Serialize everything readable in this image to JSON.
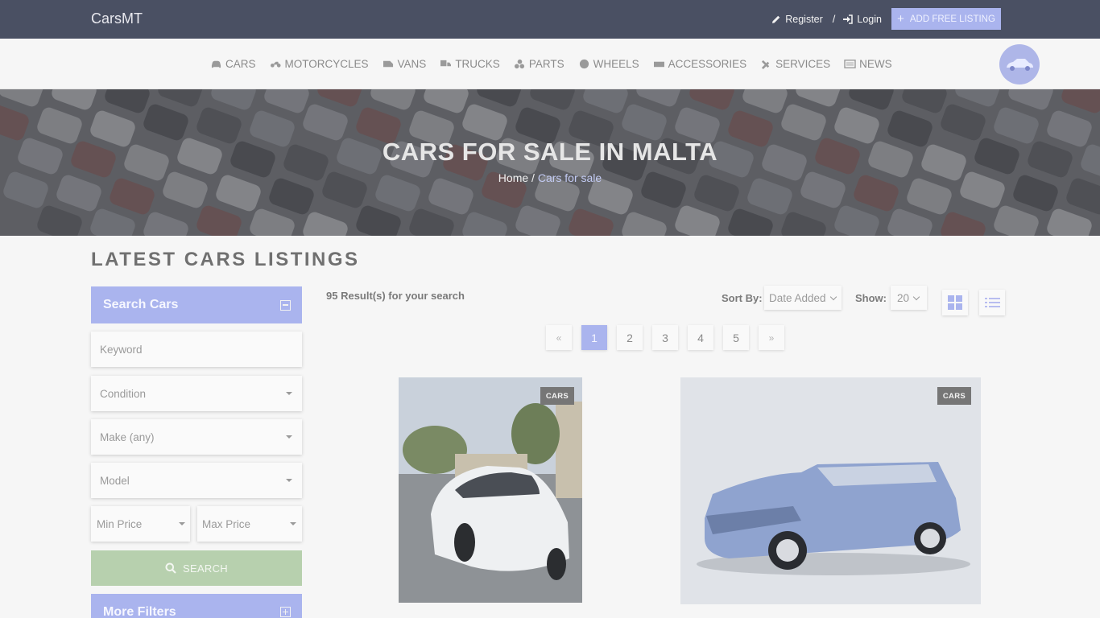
{
  "header": {
    "brand": "CarsMT",
    "register_label": "Register",
    "separator": "/",
    "login_label": "Login",
    "add_listing_label": "ADD FREE LISTING"
  },
  "nav": {
    "items": [
      {
        "label": "CARS",
        "icon": "car-icon"
      },
      {
        "label": "MOTORCYCLES",
        "icon": "motorcycle-icon"
      },
      {
        "label": "VANS",
        "icon": "van-icon"
      },
      {
        "label": "TRUCKS",
        "icon": "truck-icon"
      },
      {
        "label": "PARTS",
        "icon": "parts-icon"
      },
      {
        "label": "WHEELS",
        "icon": "wheel-icon"
      },
      {
        "label": "ACCESSORIES",
        "icon": "accessories-icon"
      },
      {
        "label": "SERVICES",
        "icon": "tools-icon"
      },
      {
        "label": "NEWS",
        "icon": "newspaper-icon"
      }
    ]
  },
  "hero": {
    "title": "CARS FOR SALE IN MALTA",
    "breadcrumb_home": "Home",
    "breadcrumb_sep": " / ",
    "breadcrumb_current": "Cars for sale"
  },
  "main": {
    "section_title": "LATEST CARS LISTINGS",
    "results_text": "95 Result(s) for your search",
    "sort_label": "Sort By:",
    "sort_value": "Date Added",
    "show_label": "Show:",
    "show_value": "20",
    "pagination": {
      "prev": "«",
      "pages": [
        "1",
        "2",
        "3",
        "4",
        "5"
      ],
      "active": "1",
      "next": "»"
    },
    "listings": [
      {
        "badge": "CARS"
      },
      {
        "badge": "CARS"
      }
    ]
  },
  "sidebar": {
    "search_title": "Search Cars",
    "keyword_placeholder": "Keyword",
    "condition": "Condition",
    "make": "Make (any)",
    "model": "Model",
    "min_price": "Min Price",
    "max_price": "Max Price",
    "search_button": "SEARCH",
    "more_filters_title": "More Filters"
  },
  "colors": {
    "accent": "#aab4ee",
    "topbar": "#4a5063",
    "search_button": "#b7d0ae"
  }
}
